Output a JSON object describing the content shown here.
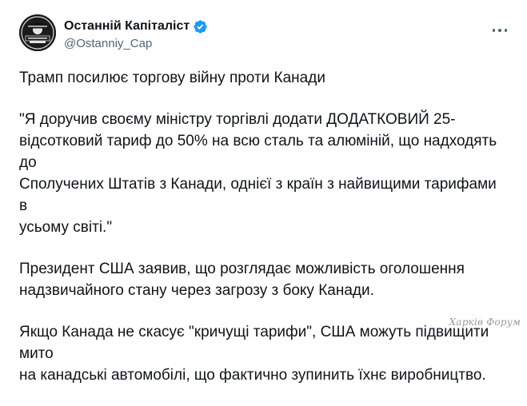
{
  "author": {
    "display_name": "Останній Капіталіст",
    "handle": "@Ostanniy_Cap",
    "verified_icon": "verified-badge-icon",
    "avatar_icon": "avatar-logo-icon",
    "avatar_logo_text": "ОСТАННІЙ КАПІТАЛІСТ"
  },
  "menu": {
    "more_icon": "more-options-icon"
  },
  "tweet": {
    "paragraphs": [
      "Трамп посилює торгову війну проти Канади",
      "\"Я доручив своєму міністру торгівлі додати ДОДАТКОВИЙ 25-\nвідсотковий тариф до 50% на всю сталь та алюміній, що надходять до\nСполучених Штатів з Канади, однієї з країн з найвищими тарифами в\nусьому світі.\"",
      "Президент США заявив, що розглядає можливість оголошення\nнадзвичайного стану через загрозу з боку Канади.",
      "Якщо Канада не скасує \"кричущі тарифи\", США можуть підвищити мито\nна канадські автомобілі, що фактично зупинить їхнє виробництво."
    ]
  },
  "watermark": {
    "text": "Харків Форум"
  },
  "colors": {
    "text_primary": "#0f1419",
    "text_secondary": "#536471",
    "verified_blue": "#1d9bf0",
    "background": "#ffffff"
  }
}
